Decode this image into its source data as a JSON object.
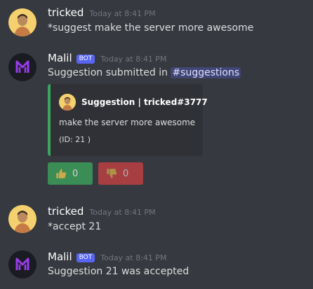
{
  "messages": [
    {
      "author": "tricked",
      "timestamp": "Today at 8:41 PM",
      "content": "*suggest make the server more awesome"
    },
    {
      "author": "Malil",
      "bot_badge": "BOT",
      "timestamp": "Today at 8:41 PM",
      "content_prefix": "Suggestion submitted in",
      "channel_mention": "#suggestions",
      "embed": {
        "accent_color": "#3ba55c",
        "author": "Suggestion | tricked#3777",
        "description": "make the server more awesome",
        "footer": "(ID: 21 )"
      },
      "buttons": [
        {
          "icon": "thumbs-up-icon",
          "count": "0",
          "color": "#3ba55c"
        },
        {
          "icon": "thumbs-down-icon",
          "count": "0",
          "color": "#ed4245"
        }
      ]
    },
    {
      "author": "tricked",
      "timestamp": "Today at 8:41 PM",
      "content": "*accept 21"
    },
    {
      "author": "Malil",
      "bot_badge": "BOT",
      "timestamp": "Today at 8:41 PM",
      "content": "Suggestion 21 was accepted"
    }
  ]
}
